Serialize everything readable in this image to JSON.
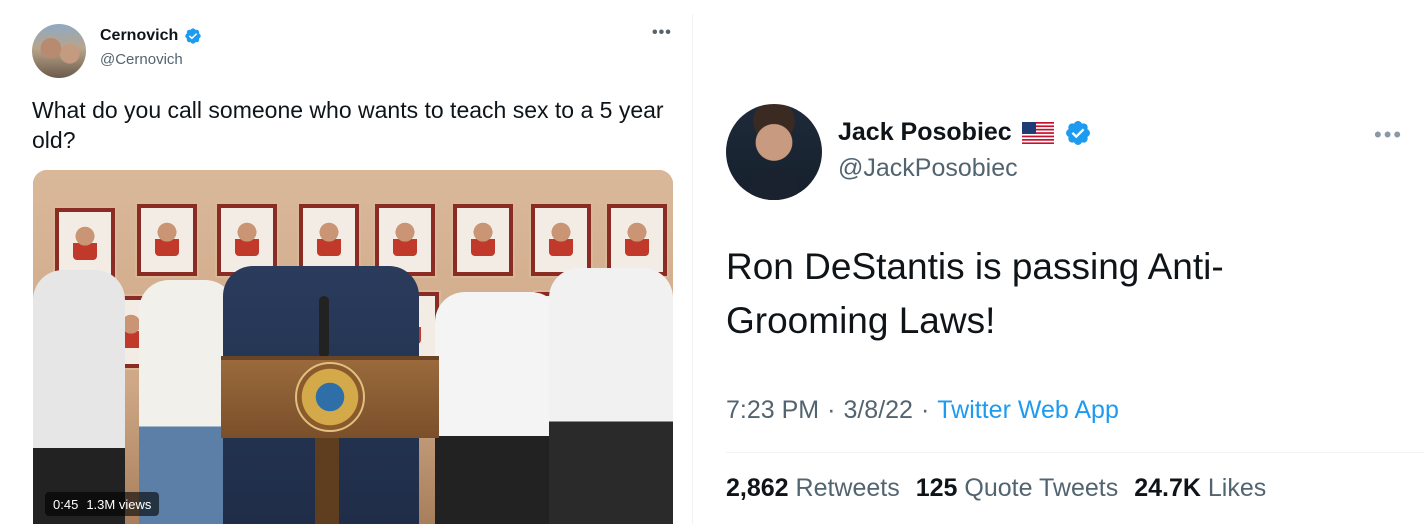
{
  "left_tweet": {
    "author_name": "Cernovich",
    "handle": "@Cernovich",
    "text": "What do you call someone who wants to teach sex to a 5 year old?",
    "more_icon": "•••",
    "video": {
      "duration": "0:45",
      "views": "1.3M views"
    }
  },
  "right_tweet": {
    "author_name": "Jack Posobiec",
    "handle": "@JackPosobiec",
    "text": "Ron DeStantis is passing Anti-Grooming Laws!",
    "more_icon": "•••",
    "time": "7:23 PM",
    "separator": "·",
    "date": "3/8/22",
    "source": "Twitter Web App",
    "stats": {
      "retweets_count": "2,862",
      "retweets_label": "Retweets",
      "quotes_count": "125",
      "quotes_label": "Quote Tweets",
      "likes_count": "24.7K",
      "likes_label": "Likes"
    }
  },
  "colors": {
    "verified_blue": "#1d9bf0",
    "secondary_text": "#536471",
    "primary_text": "#0f1419"
  },
  "icons": [
    "verified-badge-icon",
    "us-flag-icon",
    "more-options-icon"
  ]
}
